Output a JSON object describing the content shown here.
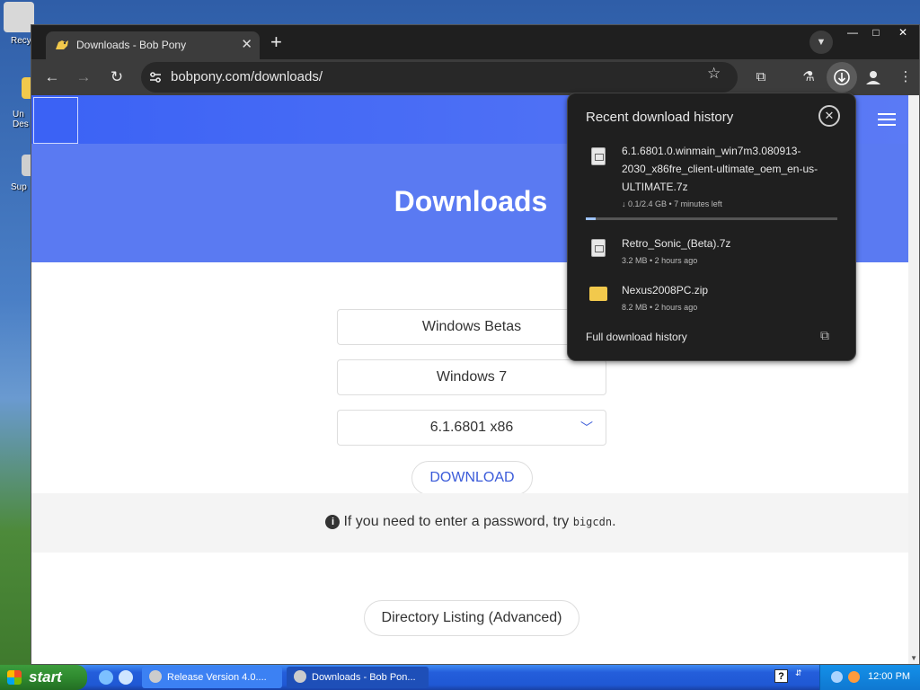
{
  "desktop": {
    "icons": [
      {
        "label": "Recy"
      },
      {
        "label": "Un\nDes"
      },
      {
        "label": "Sup"
      }
    ]
  },
  "browser": {
    "tab": {
      "title": "Downloads - Bob Pony"
    },
    "new_tab": "+",
    "omnibox": {
      "url": "bobpony.com/downloads/"
    }
  },
  "page": {
    "title": "Downloads",
    "select_category": "Windows Betas",
    "select_os": "Windows 7",
    "select_build": "6.1.6801 x86",
    "download_label": "DOWNLOAD",
    "info_text": "If you need to enter a password, try ",
    "info_code": "bigcdn",
    "info_end": ".",
    "directory_label": "Directory Listing (Advanced)"
  },
  "downloads": {
    "header": "Recent download history",
    "items": [
      {
        "name": "6.1.6801.0.winmain_win7m3.080913-2030_x86fre_client-ultimate_oem_en-us-ULTIMATE.7z",
        "meta": "↓ 0.1/2.4 GB • 7 minutes left",
        "progress": 0.04
      },
      {
        "name": "Retro_Sonic_(Beta).7z",
        "meta": "3.2 MB • 2 hours ago"
      },
      {
        "name": "Nexus2008PC.zip",
        "meta": "8.2 MB • 2 hours ago"
      }
    ],
    "footer": "Full download history"
  },
  "taskbar": {
    "start": "start",
    "tasks": [
      {
        "label": "Release Version 4.0...."
      },
      {
        "label": "Downloads - Bob Pon..."
      }
    ],
    "clock": "12:00 PM"
  }
}
